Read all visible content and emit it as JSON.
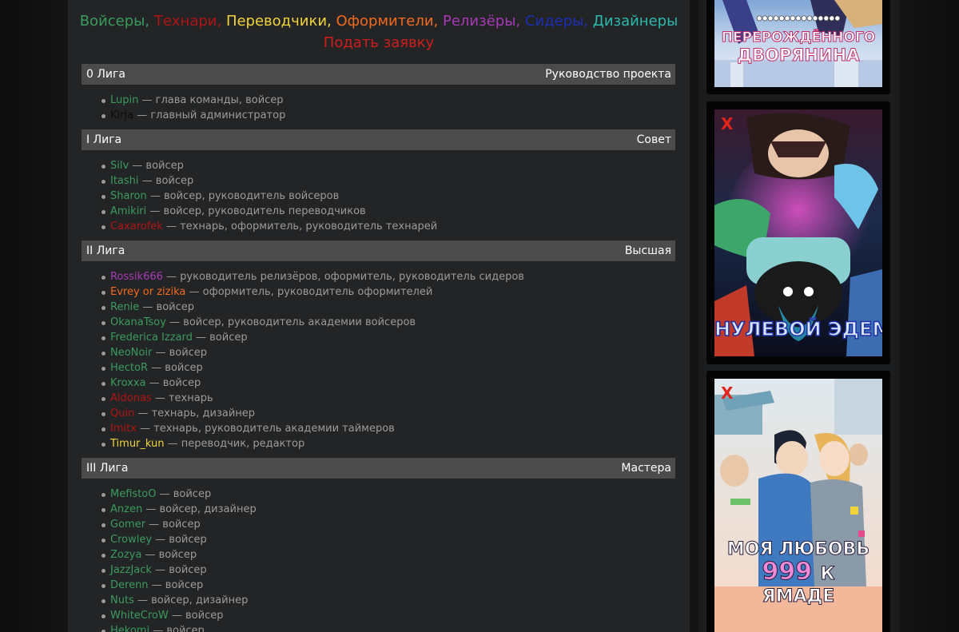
{
  "roles": [
    {
      "label": "Войсеры,",
      "color": "#3a9b5f"
    },
    {
      "label": "Технари,",
      "color": "#b01414"
    },
    {
      "label": "Переводчики,",
      "color": "#f2d43a"
    },
    {
      "label": "Оформители,",
      "color": "#f26a1d"
    },
    {
      "label": "Релизёры,",
      "color": "#a739b8"
    },
    {
      "label": "Сидеры,",
      "color": "#1c2eb5"
    },
    {
      "label": "Дизайнеры",
      "color": "#2bb8ad"
    }
  ],
  "apply_label": "Подать заявку",
  "colors": {
    "voicer": "#3a9b5f",
    "tech": "#b01414",
    "translator": "#f2d43a",
    "designer_org": "#f26a1d",
    "releaser": "#a739b8",
    "admin": "#0a0a0a",
    "text": "#9b9b9b",
    "bar": "#4b4b4b"
  },
  "leagues": [
    {
      "name": "0 Лига",
      "rank": "Руководство проекта",
      "members": [
        {
          "nick": "Lupin",
          "desc": " — глава команды, войсер",
          "color": "#3a9b5f"
        },
        {
          "nick": "Kirja",
          "desc": " — главный администратор",
          "color": "#0a0a0a"
        }
      ]
    },
    {
      "name": "I Лига",
      "rank": "Совет",
      "members": [
        {
          "nick": "Silv",
          "desc": " — войсер",
          "color": "#3a9b5f"
        },
        {
          "nick": "Itashi",
          "desc": " — войсер",
          "color": "#3a9b5f"
        },
        {
          "nick": "Sharon",
          "desc": " — войсер, руководитель войсеров",
          "color": "#3a9b5f"
        },
        {
          "nick": "Amikiri",
          "desc": " — войсер, руководитель переводчиков",
          "color": "#3a9b5f"
        },
        {
          "nick": "Caxarofek",
          "desc": " — технарь, оформитель, руководитель технарей",
          "color": "#b01414"
        }
      ]
    },
    {
      "name": "II Лига",
      "rank": "Высшая",
      "members": [
        {
          "nick": "Rossik666",
          "desc": " — руководитель релизёров, оформитель, руководитель сидеров",
          "color": "#a739b8"
        },
        {
          "nick": "Evrey or zizika",
          "desc": " — оформитель, руководитель оформителей",
          "color": "#f26a1d"
        },
        {
          "nick": "Renie",
          "desc": " — войсер",
          "color": "#3a9b5f"
        },
        {
          "nick": "OkanaTsoy",
          "desc": " — войсер, руководитель академии войсеров",
          "color": "#3a9b5f"
        },
        {
          "nick": "Frederica Izzard",
          "desc": " — войсер",
          "color": "#3a9b5f"
        },
        {
          "nick": "NeoNoir",
          "desc": " — войсер",
          "color": "#3a9b5f"
        },
        {
          "nick": "HectoR",
          "desc": " — войсер",
          "color": "#3a9b5f"
        },
        {
          "nick": "Kroxxa",
          "desc": " — войсер",
          "color": "#3a9b5f"
        },
        {
          "nick": "Aldonas",
          "desc": " — технарь",
          "color": "#b01414"
        },
        {
          "nick": "Quin",
          "desc": " — технарь, дизайнер",
          "color": "#b01414"
        },
        {
          "nick": "Imitx",
          "desc": " — технарь, руководитель академии таймеров",
          "color": "#b01414"
        },
        {
          "nick": "Timur_kun",
          "desc": " — переводчик, редактор",
          "color": "#f2d43a"
        }
      ]
    },
    {
      "name": "III Лига",
      "rank": "Мастера",
      "members": [
        {
          "nick": "MefistoO",
          "desc": " — войсер",
          "color": "#3a9b5f"
        },
        {
          "nick": "Anzen",
          "desc": " — войсер, дизайнер",
          "color": "#3a9b5f"
        },
        {
          "nick": "Gomer",
          "desc": " — войсер",
          "color": "#3a9b5f"
        },
        {
          "nick": "Crowley",
          "desc": " — войсер",
          "color": "#3a9b5f"
        },
        {
          "nick": "Zozya",
          "desc": " — войсер",
          "color": "#3a9b5f"
        },
        {
          "nick": "JazzJack",
          "desc": " — войсер",
          "color": "#3a9b5f"
        },
        {
          "nick": "Derenn",
          "desc": " — войсер",
          "color": "#3a9b5f"
        },
        {
          "nick": "Nuts",
          "desc": " — войсер, дизайнер",
          "color": "#3a9b5f"
        },
        {
          "nick": "WhiteCroW",
          "desc": " — войсер",
          "color": "#3a9b5f"
        },
        {
          "nick": "Hekomi",
          "desc": " — войсер",
          "color": "#3a9b5f"
        }
      ]
    }
  ],
  "posters": [
    {
      "title": "ПЕРЕРОЖДЁННОГО ДВОРЯНИНА",
      "icon": "anime-poster-icon"
    },
    {
      "title": "НУЛЕВОЙ ЭДЕМ",
      "icon": "anime-poster-icon"
    },
    {
      "title_lines": [
        "МОЯ ЛЮБОВЬ",
        "999",
        "К",
        "ЯМАДЕ"
      ],
      "icon": "anime-poster-icon"
    }
  ],
  "logo_mark": "Ⅹ"
}
